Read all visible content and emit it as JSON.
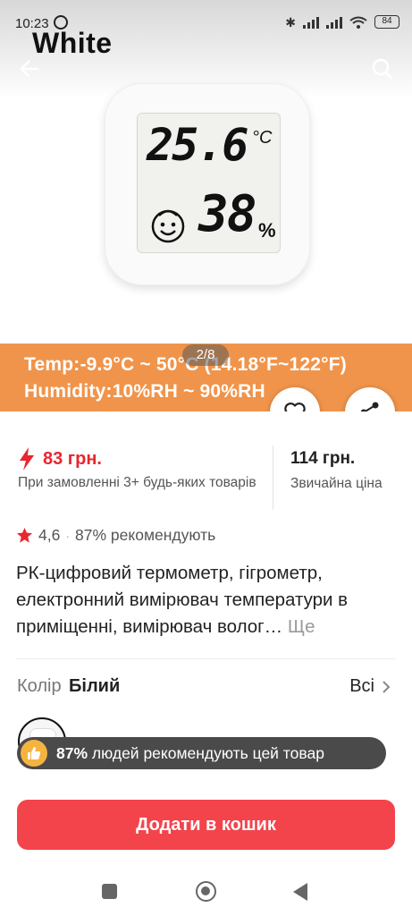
{
  "status_bar": {
    "time": "10:23",
    "battery": "84"
  },
  "header": {
    "variant_title": "White",
    "back_icon": "arrow-left-icon",
    "search_icon": "search-icon"
  },
  "gallery": {
    "lcd_temperature": "25.6",
    "lcd_temperature_unit": "°C",
    "lcd_humidity": "38",
    "lcd_humidity_unit": "%",
    "banner_line1": "Temp:-9.9°C ~ 50°C (14.18°F~122°F)",
    "banner_line2": "Humidity:10%RH ~ 90%RH",
    "pager": "2/8",
    "banner_color": "#f0944b"
  },
  "actions": {
    "favorite_icon": "heart-icon",
    "share_icon": "share-icon"
  },
  "price": {
    "promo_price": "83 грн.",
    "promo_note": "При замовленні 3+ будь-яких товарів",
    "regular_price": "114 грн.",
    "regular_label": "Звичайна ціна",
    "accent_color": "#e8262f"
  },
  "rating": {
    "score": "4,6",
    "recommend": "87% рекомендують"
  },
  "product": {
    "title": "РК-цифровий термометр, гігрометр, електронний вимірювач температури в приміщенні, вимірювач волог…",
    "more_label": "Ще"
  },
  "color_selector": {
    "label": "Колір",
    "value": "Білий",
    "all_label": "Всі"
  },
  "recommend_banner": {
    "percent": "87%",
    "text": "людей рекомендують цей товар"
  },
  "cta": {
    "add_to_cart": "Додати в кошик",
    "color": "#f3444c"
  }
}
